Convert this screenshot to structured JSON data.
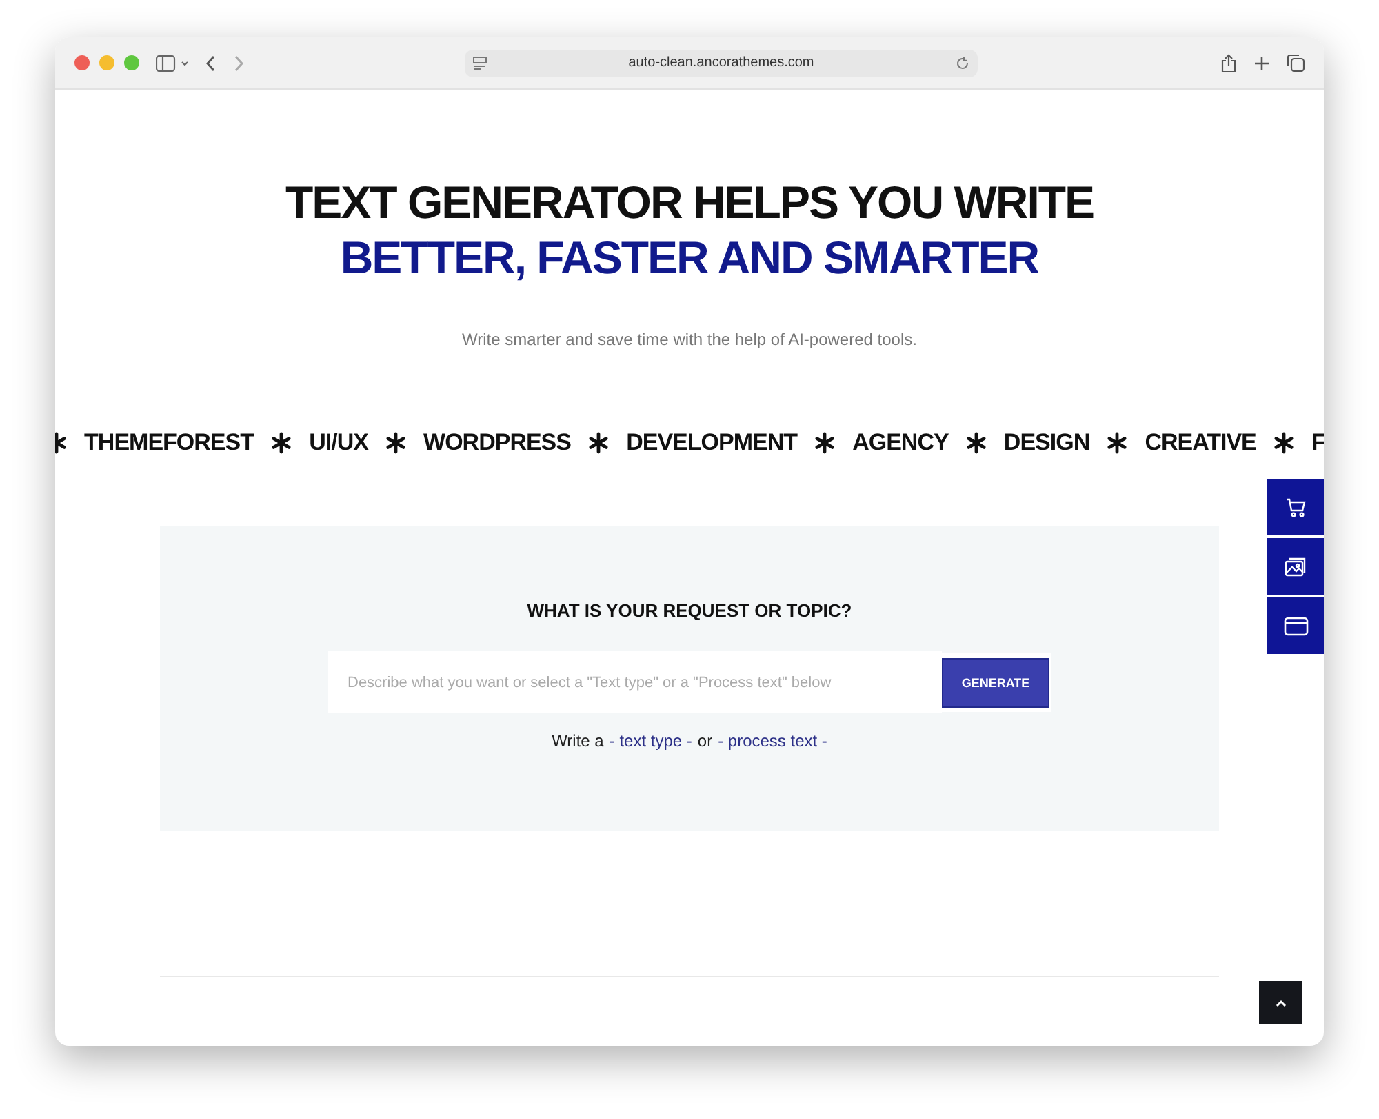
{
  "browser": {
    "url": "auto-clean.ancorathemes.com"
  },
  "hero": {
    "title_line1": "TEXT GENERATOR HELPS YOU WRITE",
    "title_line2": "BETTER, FASTER AND SMARTER",
    "subtitle": "Write smarter and save time with the help of AI-powered tools."
  },
  "marquee": [
    "THEMEFOREST",
    "UI/UX",
    "WORDPRESS",
    "DEVELOPMENT",
    "AGENCY",
    "DESIGN",
    "CREATIVE",
    "F"
  ],
  "generator": {
    "heading": "WHAT IS YOUR REQUEST OR TOPIC?",
    "placeholder": "Describe what you want or select a \"Text type\" or a \"Process text\" below",
    "button": "GENERATE",
    "hint_prefix": "Write a",
    "link1": "- text type -",
    "hint_middle": "or",
    "link2": "- process text -"
  },
  "side_buttons": [
    {
      "kind": "cart"
    },
    {
      "kind": "gallery"
    },
    {
      "kind": "window"
    }
  ]
}
